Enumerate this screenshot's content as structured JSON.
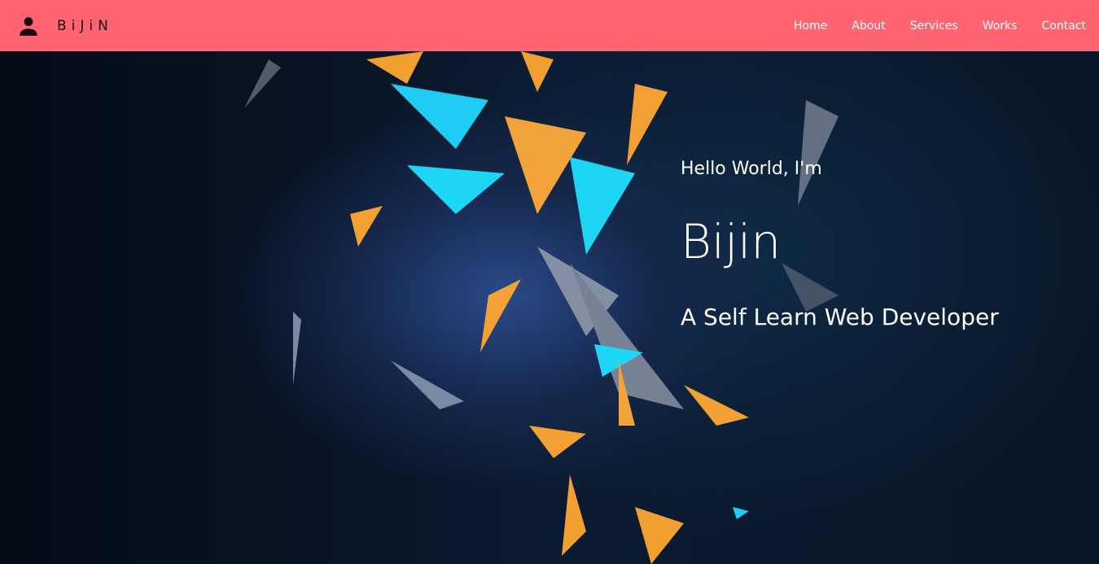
{
  "nav": {
    "brand": "BiJiN",
    "links": [
      "Home",
      "About",
      "Services",
      "Works",
      "Contact"
    ]
  },
  "hero": {
    "greeting": "Hello World, I'm",
    "name": "Bijin",
    "tagline": "A Self Learn Web Developer"
  },
  "colors": {
    "nav_bg": "#ff6571",
    "hero_bg": "#07111f"
  }
}
